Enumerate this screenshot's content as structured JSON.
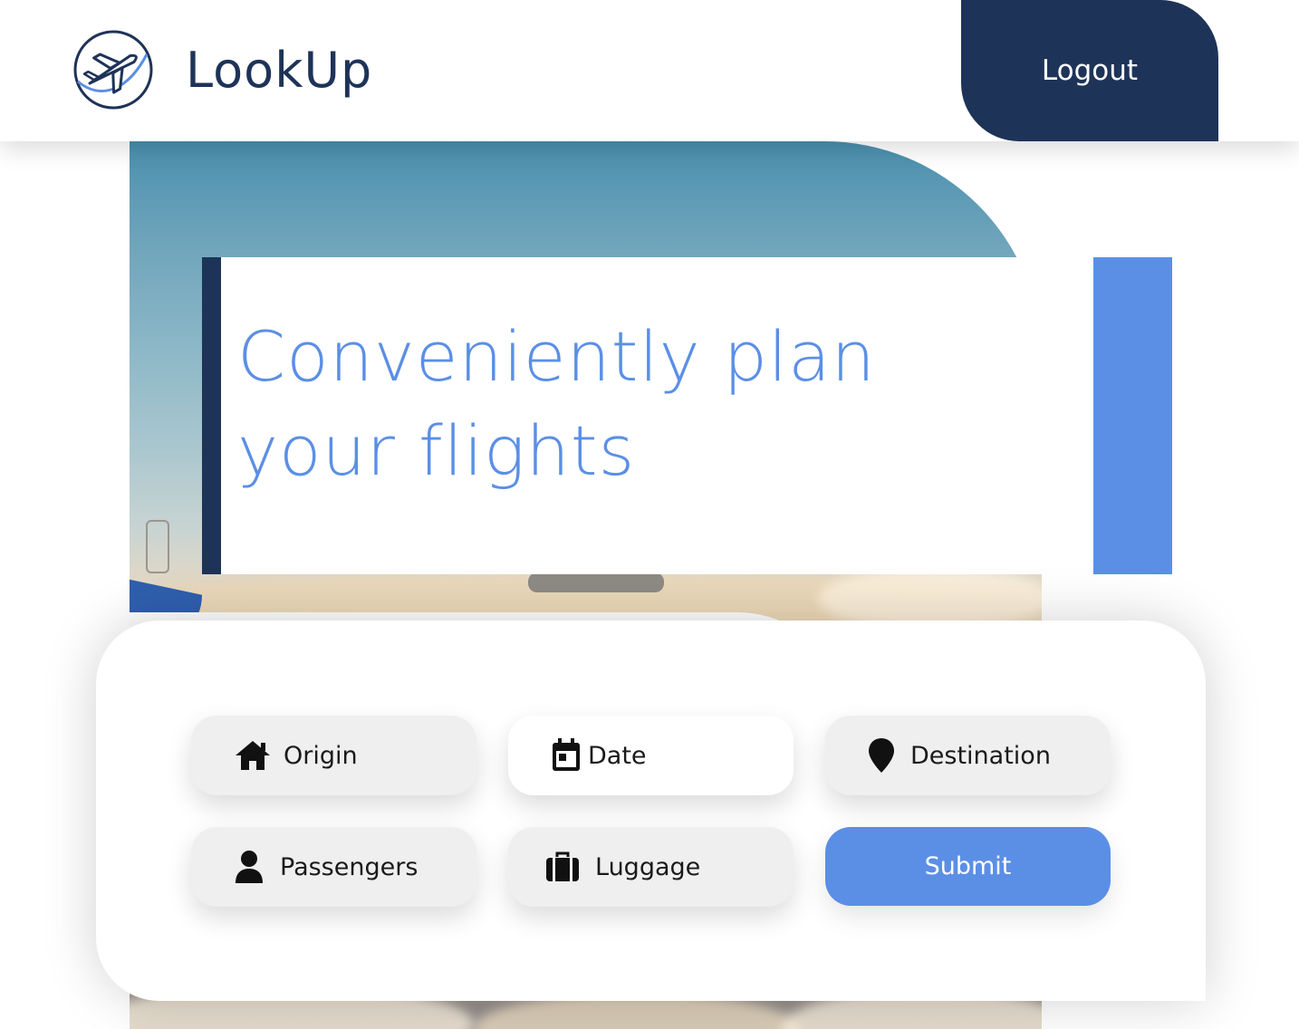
{
  "header": {
    "brand": "LookUp",
    "logout_label": "Logout"
  },
  "hero": {
    "headline_line1": "Conveniently plan",
    "headline_line2": "your flights"
  },
  "search": {
    "origin_label": "Origin",
    "date_label": "Date",
    "destination_label": "Destination",
    "passengers_label": "Passengers",
    "luggage_label": "Luggage",
    "submit_label": "Submit"
  },
  "icons": {
    "logo": "airplane-logo-icon",
    "origin": "home-icon",
    "date": "calendar-icon",
    "destination": "map-pin-icon",
    "passengers": "person-icon",
    "luggage": "suitcase-icon"
  },
  "colors": {
    "navy": "#1e3358",
    "accent_blue": "#5b8fe6",
    "field_bg": "#efefef",
    "white": "#ffffff"
  }
}
